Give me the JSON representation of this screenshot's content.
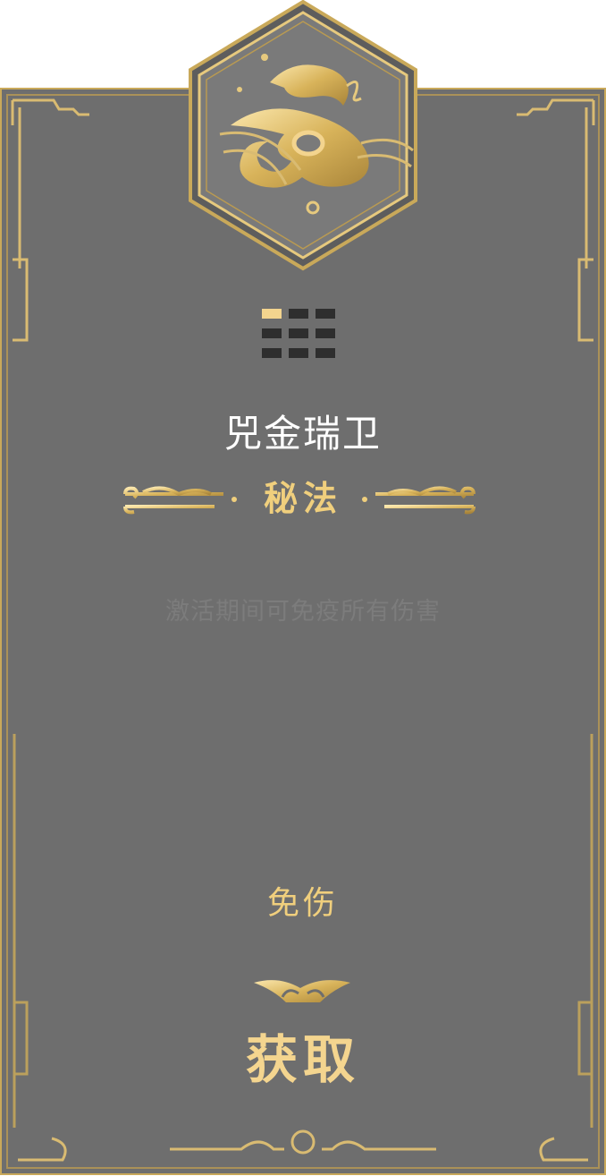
{
  "card": {
    "title": "兕金瑞卫",
    "category": "秘法",
    "description": "激活期间可免疫所有伤害",
    "effect": "免伤",
    "obtain_label": "获取",
    "emblem_icon": "golden-cloud-fish-icon",
    "level_indicator": {
      "rows": 3,
      "cols": 3,
      "active_count": 1
    }
  },
  "colors": {
    "panel": "#6e6e6e",
    "gold": "#f0cf7d",
    "gold_dark": "#b8953d",
    "title": "#ffffff",
    "description": "#7c7c7c",
    "inactive_cell": "#2e2e2e"
  }
}
